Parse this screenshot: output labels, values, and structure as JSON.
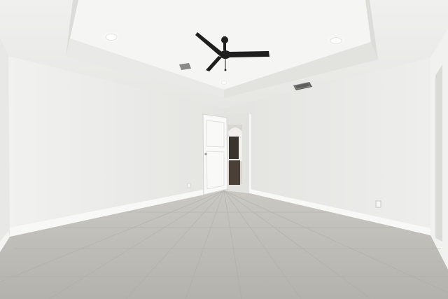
{
  "scene": {
    "subject": "empty-room",
    "colors": {
      "wall": "#ececea",
      "ceiling": "#f3f3f1",
      "floor": "#bdbcb7",
      "trim": "#f7f7f5",
      "fan": "#1f1f1f",
      "doorway_dark": "#3a342e"
    },
    "objects": [
      "ceiling-fan",
      "recessed-light",
      "hvac-vent",
      "open-door",
      "baseboard",
      "outlet",
      "tile-floor",
      "tray-ceiling"
    ]
  }
}
